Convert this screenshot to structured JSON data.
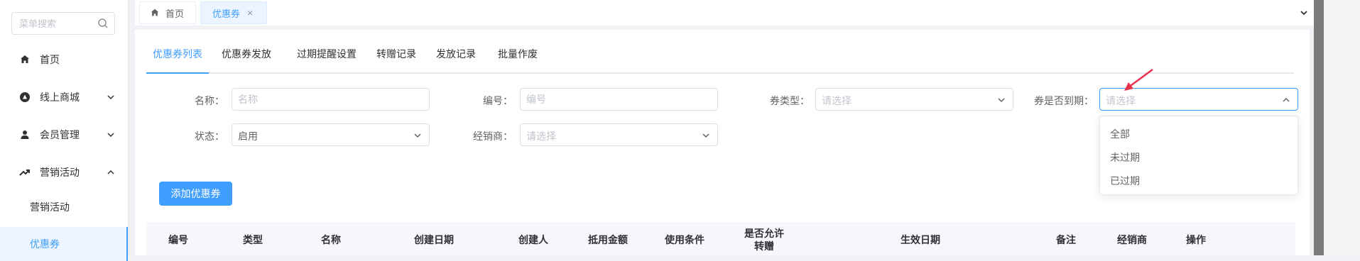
{
  "sidebar": {
    "search_placeholder": "菜单搜索",
    "items": [
      {
        "label": "首页",
        "icon": "home-icon"
      },
      {
        "label": "线上商城",
        "icon": "shop-icon"
      },
      {
        "label": "会员管理",
        "icon": "user-icon"
      },
      {
        "label": "营销活动",
        "icon": "trend-icon"
      }
    ],
    "submenu": [
      {
        "label": "营销活动"
      },
      {
        "label": "优惠券",
        "active": true
      }
    ]
  },
  "tabs": {
    "home": "首页",
    "active": "优惠券",
    "close": "×"
  },
  "subtabs": [
    "优惠券列表",
    "优惠券发放",
    "过期提醒设置",
    "转赠记录",
    "发放记录",
    "批量作废"
  ],
  "form": {
    "name_label": "名称：",
    "name_placeholder": "名称",
    "code_label": "编号：",
    "code_placeholder": "编号",
    "type_label": "券类型：",
    "type_placeholder": "请选择",
    "expired_label": "券是否到期：",
    "expired_placeholder": "请选择",
    "status_label": "状态：",
    "status_value": "启用",
    "dealer_label": "经销商：",
    "dealer_placeholder": "请选择"
  },
  "expired_options": [
    "全部",
    "未过期",
    "已过期"
  ],
  "add_button": "添加优惠券",
  "table": {
    "headers": [
      "编号",
      "类型",
      "名称",
      "创建日期",
      "创建人",
      "抵用金额",
      "使用条件",
      "是否允许转赠",
      "生效日期",
      "备注",
      "经销商",
      "操作"
    ]
  },
  "colors": {
    "accent": "#409eff",
    "annotation_arrow": "#e8324a"
  }
}
